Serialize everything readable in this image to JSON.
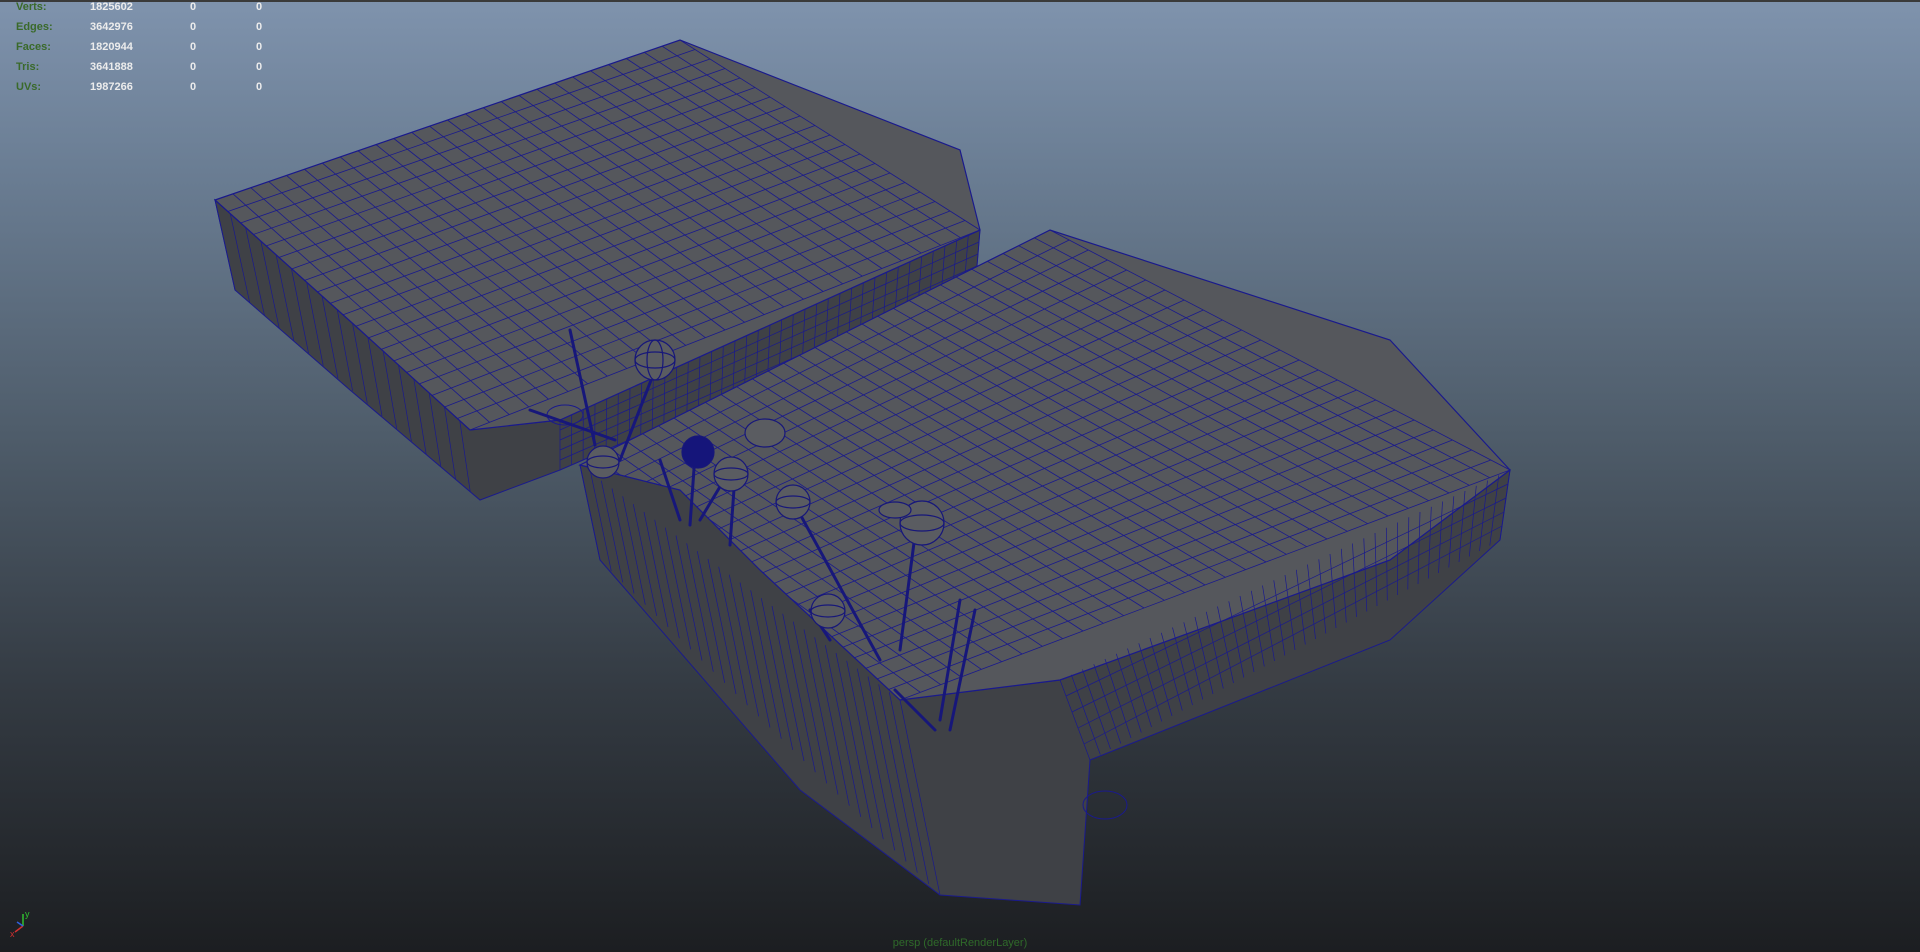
{
  "hud": {
    "rows": [
      {
        "label": "Verts:",
        "value": "1825602",
        "selected": "0",
        "selected_component": "0"
      },
      {
        "label": "Edges:",
        "value": "3642976",
        "selected": "0",
        "selected_component": "0"
      },
      {
        "label": "Faces:",
        "value": "1820944",
        "selected": "0",
        "selected_component": "0"
      },
      {
        "label": "Tris:",
        "value": "3641888",
        "selected": "0",
        "selected_component": "0"
      },
      {
        "label": "UVs:",
        "value": "1987266",
        "selected": "0",
        "selected_component": "0"
      }
    ]
  },
  "axis_gizmo": {
    "x_label": "x",
    "y_label": "y"
  },
  "camera_label": "persp (defaultRenderLayer)",
  "colors": {
    "wireframe": "#1a1a8c",
    "mesh_fill": "#55575c",
    "mesh_side": "#43454a",
    "background_top": "#7f93ad",
    "background_bottom": "#1c1e21",
    "hud_label": "#3a6a2a",
    "hud_value": "#ececec"
  }
}
